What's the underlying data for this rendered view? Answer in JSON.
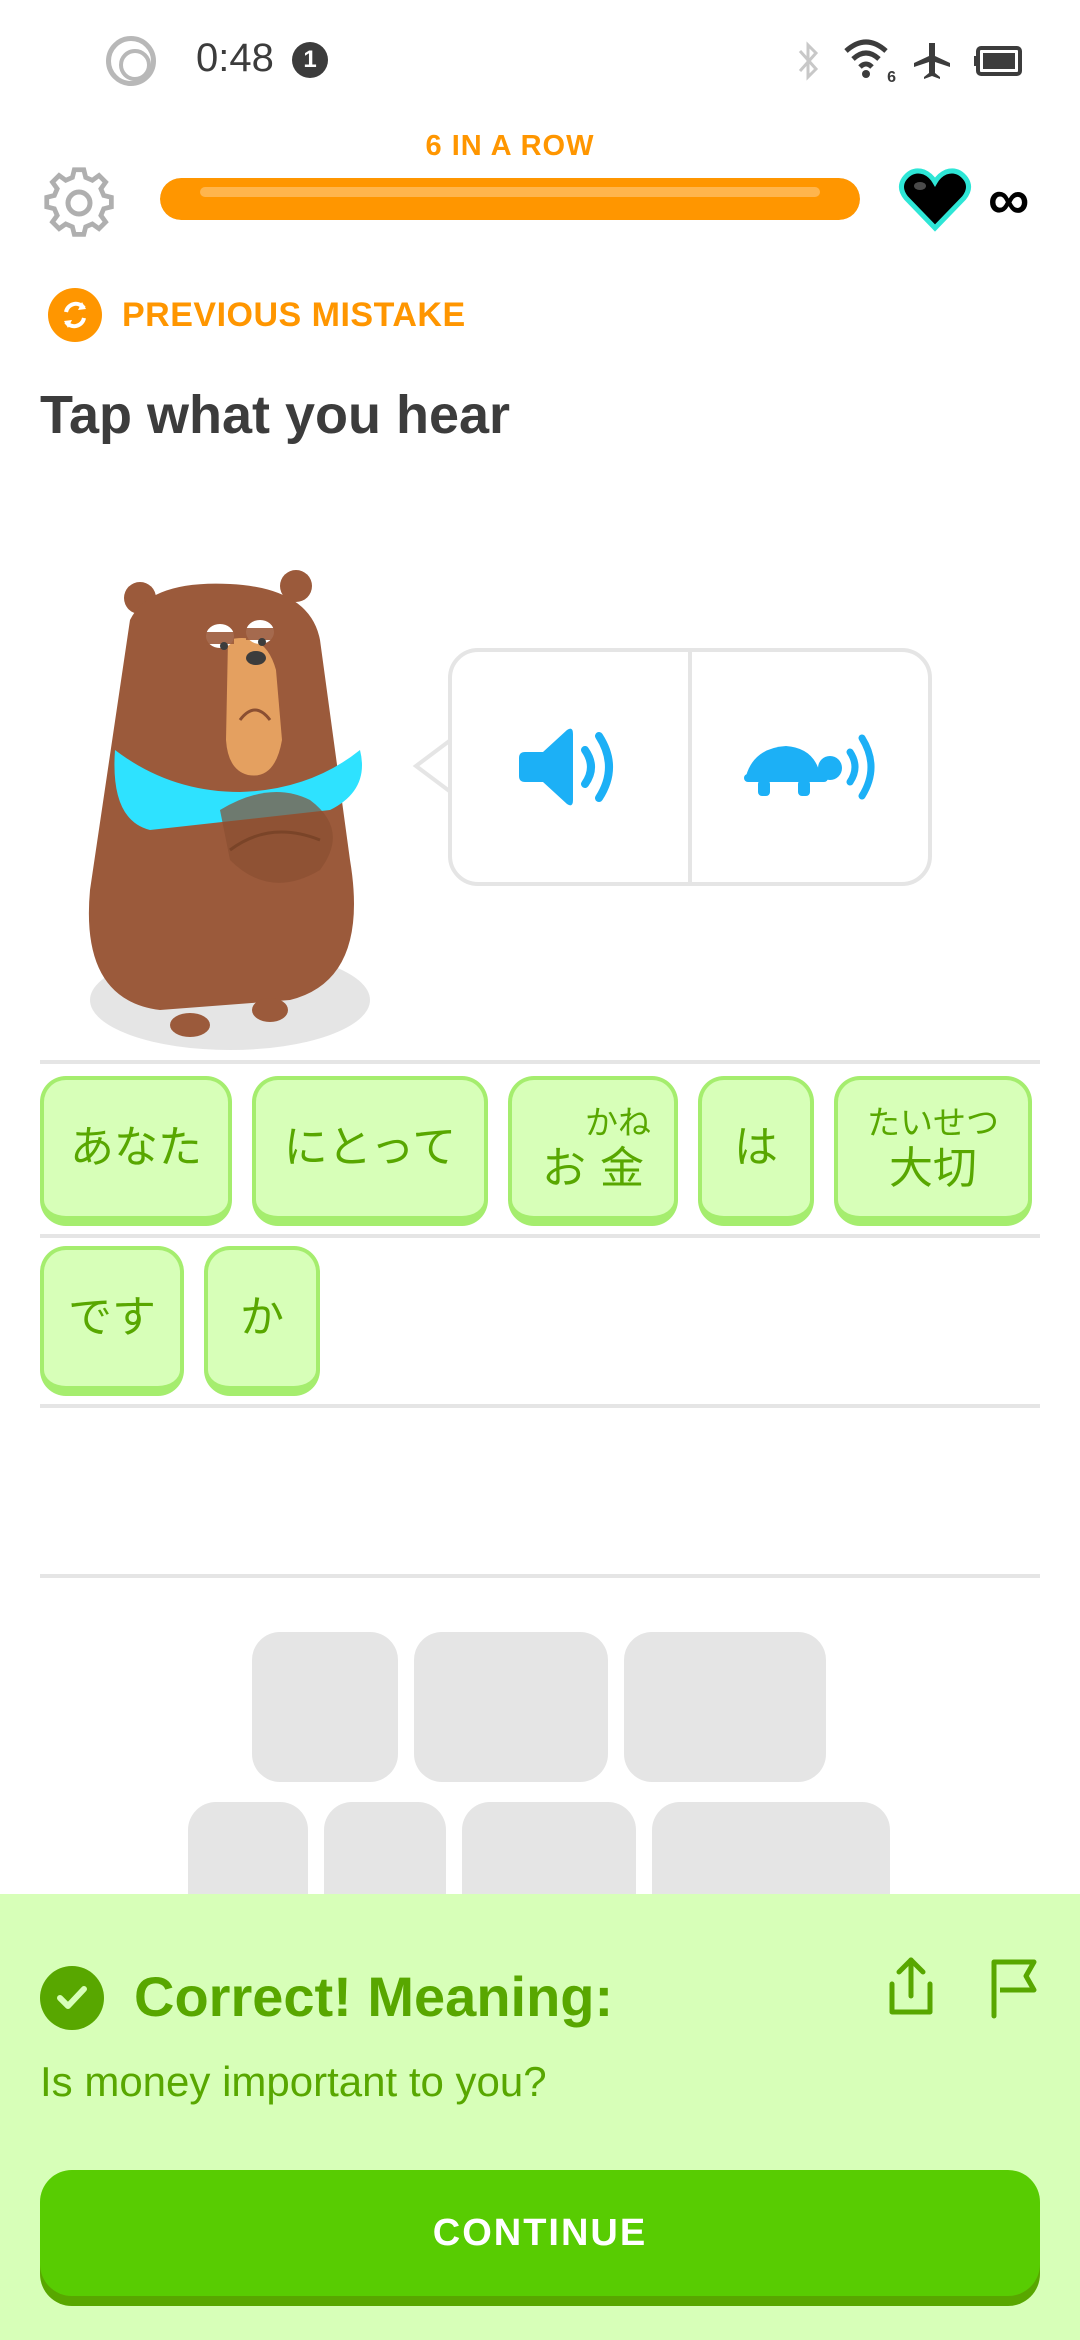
{
  "status_bar": {
    "time": "0:48",
    "notification_count": "1",
    "wifi_label": "6"
  },
  "header": {
    "streak_label": "6 IN A ROW",
    "progress_fraction": 1.0,
    "hearts": "∞"
  },
  "previous_mistake_label": "PREVIOUS MISTAKE",
  "instruction": "Tap what you hear",
  "audio": {
    "normal_icon": "speaker-icon",
    "slow_icon": "turtle-speaker-icon"
  },
  "answer": {
    "tiles": [
      {
        "text": "あなた",
        "ruby": ""
      },
      {
        "text": "にとって",
        "ruby": ""
      },
      {
        "text": "お 金",
        "ruby": "かね"
      },
      {
        "text": "は",
        "ruby": ""
      },
      {
        "text": "大切",
        "ruby": "たいせつ"
      },
      {
        "text": "です",
        "ruby": ""
      },
      {
        "text": "か",
        "ruby": ""
      }
    ]
  },
  "feedback": {
    "title": "Correct! Meaning:",
    "meaning": "Is money important to you?",
    "continue_label": "CONTINUE"
  },
  "colors": {
    "accent_orange": "#ff9600",
    "correct_green": "#58a700",
    "button_green": "#58cc02",
    "panel_green": "#d7ffb8",
    "audio_blue": "#1cb0f6"
  }
}
